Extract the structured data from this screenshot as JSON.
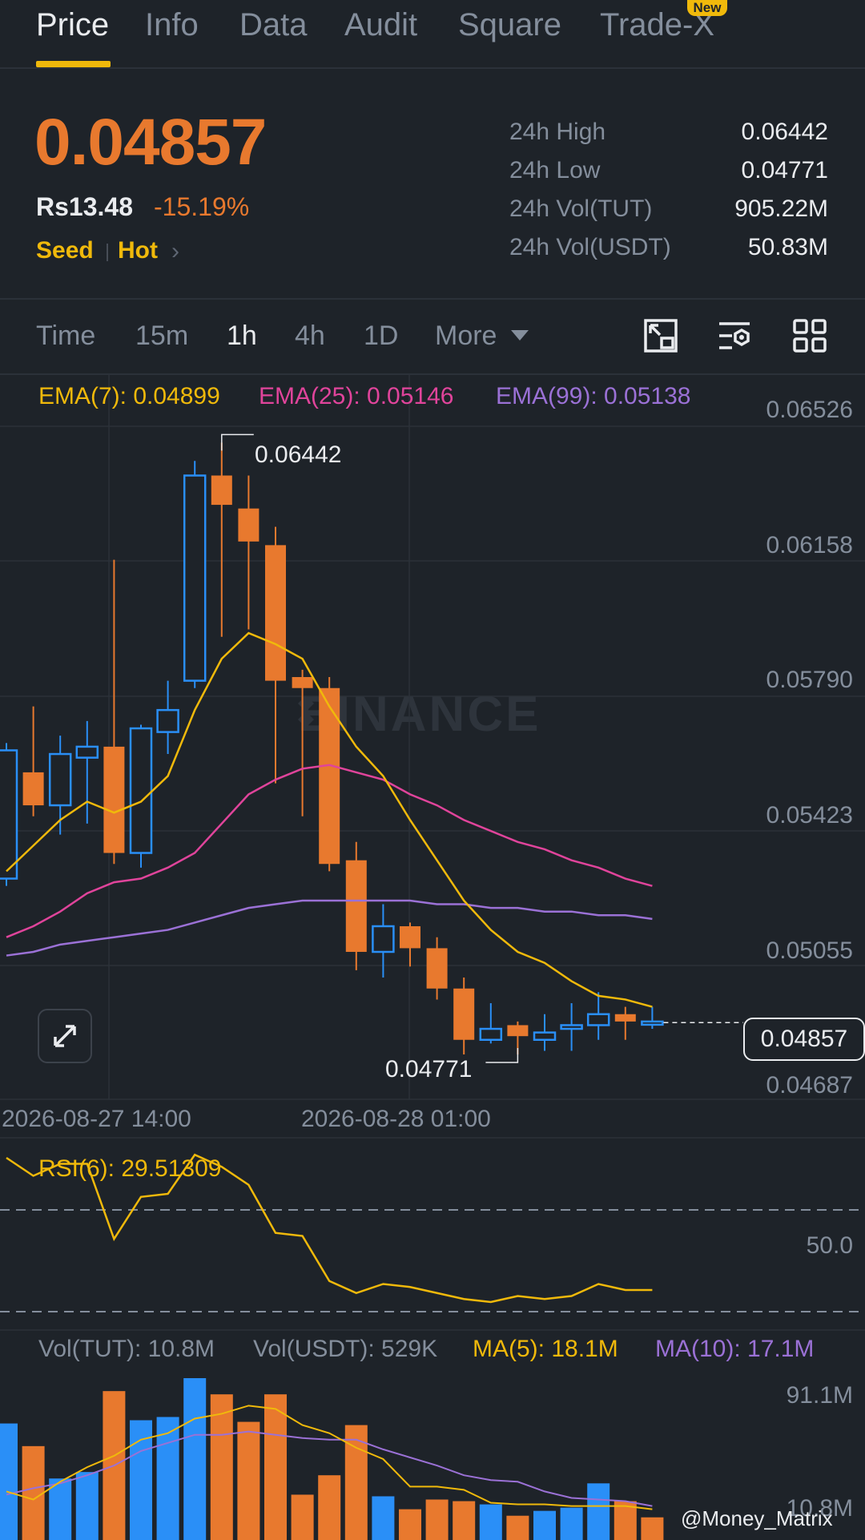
{
  "tabs": [
    {
      "label": "Price",
      "active": true
    },
    {
      "label": "Info"
    },
    {
      "label": "Data"
    },
    {
      "label": "Audit"
    },
    {
      "label": "Square"
    },
    {
      "label": "Trade-X",
      "badge": "New"
    }
  ],
  "ticker": {
    "price": "0.04857",
    "fiat": "Rs13.48",
    "change": "-15.19%",
    "tags": [
      "Seed",
      "Hot"
    ],
    "stats": [
      {
        "label": "24h High",
        "value": "0.06442"
      },
      {
        "label": "24h Low",
        "value": "0.04771"
      },
      {
        "label": "24h Vol(TUT)",
        "value": "905.22M"
      },
      {
        "label": "24h Vol(USDT)",
        "value": "50.83M"
      }
    ]
  },
  "intervals": {
    "items": [
      "Time",
      "15m",
      "1h",
      "4h",
      "1D",
      "More"
    ],
    "selected": "1h"
  },
  "toolbar_icons": [
    "depth-chart-icon",
    "indicator-settings-icon",
    "grid-layout-icon"
  ],
  "colors": {
    "up": "#2a8ff7",
    "down": "#e8792e",
    "ema7": "#f0b90b",
    "ema25": "#e0449b",
    "ema99": "#9b71d6",
    "bg": "#1e2329"
  },
  "chart_data": [
    {
      "type": "candlestick",
      "legend": [
        {
          "label": "EMA(7): 0.04899",
          "color": "#f0b90b"
        },
        {
          "label": "EMA(25): 0.05146",
          "color": "#e0449b"
        },
        {
          "label": "EMA(99): 0.05138",
          "color": "#9b71d6"
        }
      ],
      "y_ticks": [
        "0.06526",
        "0.06158",
        "0.05790",
        "0.05423",
        "0.05055",
        "0.04687"
      ],
      "ylim": [
        0.04687,
        0.06526
      ],
      "x_ticks": [
        "2026-08-27 14:00",
        "2026-08-28 01:00"
      ],
      "current_price": "0.04857",
      "high_marker": "0.06442",
      "low_marker": "0.04771",
      "candles": [
        {
          "o": 0.0525,
          "h": 0.0562,
          "l": 0.0523,
          "c": 0.056
        },
        {
          "o": 0.0554,
          "h": 0.0572,
          "l": 0.0542,
          "c": 0.0545
        },
        {
          "o": 0.0545,
          "h": 0.0564,
          "l": 0.0537,
          "c": 0.0559
        },
        {
          "o": 0.0558,
          "h": 0.0568,
          "l": 0.054,
          "c": 0.0561
        },
        {
          "o": 0.0561,
          "h": 0.0612,
          "l": 0.0529,
          "c": 0.0532
        },
        {
          "o": 0.0532,
          "h": 0.0567,
          "l": 0.0528,
          "c": 0.0566
        },
        {
          "o": 0.0565,
          "h": 0.0579,
          "l": 0.0559,
          "c": 0.0571
        },
        {
          "o": 0.0579,
          "h": 0.0639,
          "l": 0.0577,
          "c": 0.0635
        },
        {
          "o": 0.0635,
          "h": 0.0644,
          "l": 0.0591,
          "c": 0.0627
        },
        {
          "o": 0.0626,
          "h": 0.0635,
          "l": 0.0593,
          "c": 0.0617
        },
        {
          "o": 0.0616,
          "h": 0.0621,
          "l": 0.0551,
          "c": 0.0579
        },
        {
          "o": 0.058,
          "h": 0.0582,
          "l": 0.0542,
          "c": 0.0577
        },
        {
          "o": 0.0577,
          "h": 0.058,
          "l": 0.0527,
          "c": 0.0529
        },
        {
          "o": 0.053,
          "h": 0.0535,
          "l": 0.05,
          "c": 0.0505
        },
        {
          "o": 0.0505,
          "h": 0.0518,
          "l": 0.0498,
          "c": 0.0512
        },
        {
          "o": 0.0512,
          "h": 0.0513,
          "l": 0.0501,
          "c": 0.0506
        },
        {
          "o": 0.0506,
          "h": 0.0509,
          "l": 0.0492,
          "c": 0.0495
        },
        {
          "o": 0.0495,
          "h": 0.0498,
          "l": 0.0477,
          "c": 0.0481
        },
        {
          "o": 0.0481,
          "h": 0.0491,
          "l": 0.048,
          "c": 0.0484
        },
        {
          "o": 0.0485,
          "h": 0.0486,
          "l": 0.0477,
          "c": 0.0482
        },
        {
          "o": 0.0481,
          "h": 0.0488,
          "l": 0.0478,
          "c": 0.0483
        },
        {
          "o": 0.0484,
          "h": 0.0491,
          "l": 0.0478,
          "c": 0.0485
        },
        {
          "o": 0.0485,
          "h": 0.0494,
          "l": 0.0481,
          "c": 0.0488
        },
        {
          "o": 0.0488,
          "h": 0.049,
          "l": 0.0481,
          "c": 0.0486
        },
        {
          "o": 0.0486,
          "h": 0.049,
          "l": 0.0484,
          "c": 0.0486
        }
      ],
      "ema7": [
        0.0527,
        0.0534,
        0.0541,
        0.0546,
        0.0543,
        0.0546,
        0.0553,
        0.0571,
        0.0585,
        0.0592,
        0.0589,
        0.0585,
        0.0572,
        0.0561,
        0.0553,
        0.0541,
        0.053,
        0.0519,
        0.0511,
        0.0505,
        0.0502,
        0.0497,
        0.0493,
        0.0492,
        0.049
      ],
      "ema25": [
        0.0509,
        0.0512,
        0.0516,
        0.0521,
        0.0524,
        0.0525,
        0.0528,
        0.0532,
        0.054,
        0.0548,
        0.0552,
        0.0555,
        0.0556,
        0.0554,
        0.0552,
        0.0548,
        0.0545,
        0.0541,
        0.0538,
        0.0535,
        0.0533,
        0.053,
        0.0528,
        0.0525,
        0.0523
      ],
      "ema99": [
        0.0504,
        0.0505,
        0.0507,
        0.0508,
        0.0509,
        0.051,
        0.0511,
        0.0513,
        0.0515,
        0.0517,
        0.0518,
        0.0519,
        0.0519,
        0.0519,
        0.0519,
        0.0519,
        0.0518,
        0.0518,
        0.0517,
        0.0517,
        0.0516,
        0.0516,
        0.0515,
        0.0515,
        0.0514
      ]
    },
    {
      "type": "line",
      "label": "RSI(6): 29.51309",
      "y_tick": "50.0",
      "ylim": [
        25,
        85
      ],
      "values": [
        81,
        75,
        79,
        79,
        54,
        68,
        69,
        82,
        78,
        72,
        56,
        55,
        40,
        36,
        39,
        38,
        36,
        34,
        33,
        35,
        34,
        35,
        39,
        37,
        37
      ]
    },
    {
      "type": "bar",
      "legend": [
        {
          "label": "Vol(TUT): 10.8M",
          "color": "#848e9c"
        },
        {
          "label": "Vol(USDT): 529K",
          "color": "#848e9c"
        },
        {
          "label": "MA(5): 18.1M",
          "color": "#f0b90b"
        },
        {
          "label": "MA(10): 17.1M",
          "color": "#9b71d6"
        }
      ],
      "y_ticks": [
        "91.1M",
        "10.8M"
      ],
      "ylim": [
        0,
        100
      ],
      "values": [
        72,
        58,
        38,
        42,
        92,
        74,
        76,
        100,
        90,
        73,
        90,
        28,
        40,
        71,
        27,
        19,
        25,
        24,
        22,
        15,
        18,
        20,
        35,
        24,
        14
      ],
      "up": [
        true,
        false,
        true,
        true,
        false,
        true,
        true,
        true,
        false,
        false,
        false,
        false,
        false,
        false,
        true,
        false,
        false,
        false,
        true,
        false,
        true,
        true,
        true,
        false,
        false
      ],
      "ma5": [
        30,
        25,
        36,
        45,
        52,
        62,
        66,
        75,
        78,
        83,
        81,
        71,
        66,
        57,
        50,
        33,
        33,
        31,
        23,
        22,
        22,
        21,
        21,
        21,
        19
      ],
      "ma10": [
        28,
        32,
        35,
        40,
        46,
        55,
        60,
        65,
        65,
        67,
        65,
        63,
        62,
        62,
        56,
        51,
        46,
        40,
        37,
        36,
        30,
        26,
        25,
        24,
        21
      ]
    }
  ],
  "credit": "@Money_Matrix"
}
